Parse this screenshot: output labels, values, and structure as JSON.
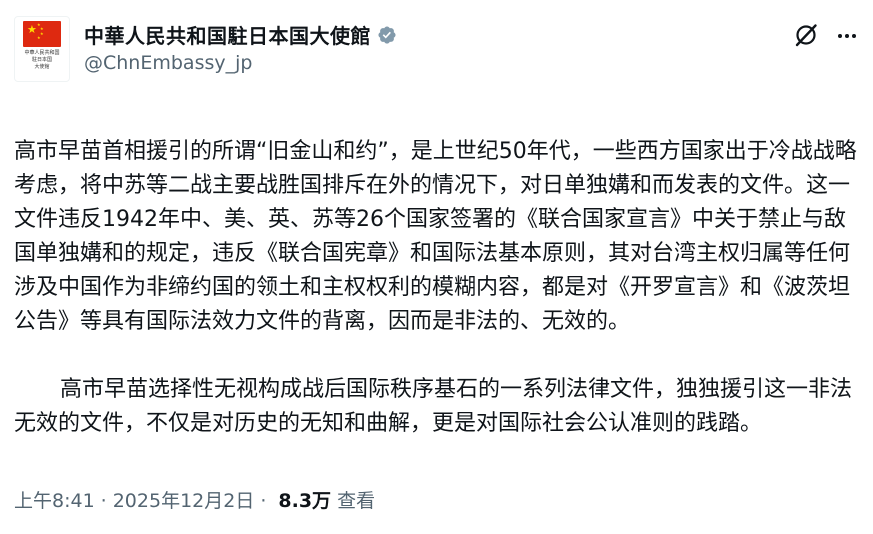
{
  "header": {
    "avatar_icon": "china-flag-emblem",
    "avatar_caption": [
      "中華人民共和国",
      "駐日本国",
      "大使館"
    ],
    "display_name": "中華人民共和国駐日本国大使館",
    "verified_icon": "verified-badge-icon",
    "verified_color": "#829aab",
    "handle": "@ChnEmbassy_jp",
    "grok_icon": "grok-icon",
    "more_icon": "more-options-icon"
  },
  "post": {
    "paragraph_1": "高市早苗首相援引的所谓“旧金山和约”，是上世纪50年代，一些西方国家出于冷战战略考虑，将中苏等二战主要战胜国排斥在外的情况下，对日单独媾和而发表的文件。这一文件违反1942年中、美、英、苏等26个国家签署的《联合国家宣言》中关于禁止与敌国单独媾和的规定，违反《联合国宪章》和国际法基本原则，其对台湾主权归属等任何涉及中国作为非缔约国的领土和主权权利的模糊内容，都是对《开罗宣言》和《波茨坦公告》等具有国际法效力文件的背离，因而是非法的、无效的。",
    "paragraph_2": "高市早苗选择性无视构成战后国际秩序基石的一系列法律文件，独独援引这一非法无效的文件，不仅是对历史的无知和曲解，更是对国际社会公认准则的践踏。"
  },
  "meta": {
    "time": "上午8:41",
    "separator": "·",
    "date": "2025年12月2日",
    "views_count": "8.3万",
    "views_label": "查看"
  },
  "colors": {
    "text": "#0f1419",
    "secondary": "#536471",
    "flag_red": "#de2910",
    "flag_yellow": "#ffde00"
  }
}
